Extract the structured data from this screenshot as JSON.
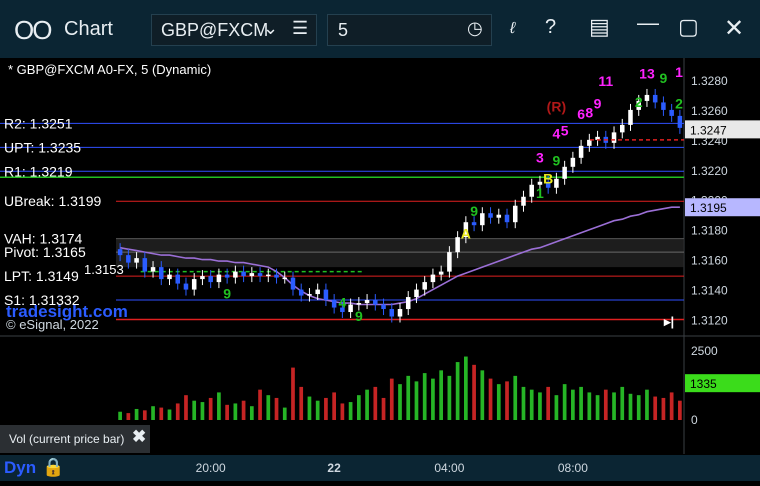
{
  "window": {
    "title": "Chart",
    "symbol": "GBP@FXCM",
    "interval": "5"
  },
  "chart_header": "* GBP@FXCM A0-FX, 5 (Dynamic)",
  "copyright": "© eSignal, 2022",
  "watermark": "tradesight.com",
  "study_label": "Vol (current price bar)",
  "bottom": {
    "label": "Dyn"
  },
  "colors": {
    "background": "#000000",
    "up_candle": "#ffffff",
    "down_candle": "#2b5cff",
    "ma_line": "#9b6fd6",
    "r2_line": "#3050ff",
    "r1_line": "#3050ff",
    "ubreak_line": "#e02020",
    "green_line": "#21c021",
    "vah_band": "#2a2a2a",
    "current_price": "#e8e8e8",
    "ma_price": "#b7b7ff",
    "vol_current": "#3bdc1b"
  },
  "chart_data": {
    "type": "candlestick",
    "ylim": [
      1.3113,
      1.3292
    ],
    "yticks": [
      "1.3280",
      "1.3260",
      "1.3240",
      "1.3220",
      "1.3200",
      "1.3180",
      "1.3160",
      "1.3140",
      "1.3120"
    ],
    "xticks": [
      {
        "i": 11,
        "label": "20:00"
      },
      {
        "i": 26,
        "label": "22"
      },
      {
        "i": 40,
        "label": "04:00"
      },
      {
        "i": 55,
        "label": "08:00"
      }
    ],
    "n_bars": 69,
    "current_price": "1.3247",
    "ma_price": "1.3195",
    "levels": [
      {
        "label": "R2: 1.3251",
        "value": 1.3251,
        "type": "r2"
      },
      {
        "label": "UPT: 1.3235",
        "value": 1.3235,
        "type": "r2"
      },
      {
        "label": "R1: 1.3219",
        "value": 1.3219,
        "type": "r1"
      },
      {
        "label": "UBreak: 1.3199",
        "value": 1.3199,
        "type": "ubreak"
      },
      {
        "label": "VAH: 1.3174",
        "value": 1.3174,
        "type": "vah"
      },
      {
        "label": "Pivot: 1.3165",
        "value": 1.3165,
        "type": "pivot"
      },
      {
        "label": "LPT: 1.3149",
        "value": 1.3149,
        "type": "ubreak"
      },
      {
        "label": "S1: 1.31332",
        "value": 1.3133,
        "type": "r1"
      }
    ],
    "hidden_level_label": "1.3153",
    "close": [
      1.3163,
      1.3158,
      1.3161,
      1.3152,
      1.3155,
      1.3147,
      1.315,
      1.3144,
      1.314,
      1.3147,
      1.3149,
      1.3145,
      1.315,
      1.3148,
      1.3152,
      1.3149,
      1.3151,
      1.3149,
      1.315,
      1.3148,
      1.3148,
      1.314,
      1.3136,
      1.3137,
      1.314,
      1.3133,
      1.3128,
      1.3125,
      1.313,
      1.3131,
      1.3133,
      1.313,
      1.3127,
      1.3122,
      1.3127,
      1.3135,
      1.314,
      1.3145,
      1.315,
      1.3152,
      1.3165,
      1.3175,
      1.3185,
      1.3183,
      1.3191,
      1.3188,
      1.319,
      1.3185,
      1.3196,
      1.3202,
      1.321,
      1.3212,
      1.3208,
      1.3214,
      1.3222,
      1.3228,
      1.3236,
      1.324,
      1.3242,
      1.3238,
      1.3245,
      1.325,
      1.326,
      1.3266,
      1.327,
      1.3265,
      1.326,
      1.3256,
      1.3248
    ],
    "ma": [
      1.3168,
      1.3167,
      1.3166,
      1.3165,
      1.3164,
      1.3163,
      1.3163,
      1.3162,
      1.3161,
      1.3161,
      1.316,
      1.316,
      1.3159,
      1.3159,
      1.3158,
      1.3158,
      1.3157,
      1.3156,
      1.3155,
      1.3152,
      1.3148,
      1.3143,
      1.3139,
      1.3136,
      1.3134,
      1.3133,
      1.3132,
      1.3131,
      1.3131,
      1.313,
      1.313,
      1.313,
      1.313,
      1.313,
      1.3131,
      1.3132,
      1.3134,
      1.3137,
      1.314,
      1.3143,
      1.3146,
      1.3149,
      1.3151,
      1.3153,
      1.3155,
      1.3157,
      1.3159,
      1.3161,
      1.3163,
      1.3165,
      1.3167,
      1.3168,
      1.317,
      1.3172,
      1.3174,
      1.3176,
      1.3178,
      1.318,
      1.3182,
      1.3184,
      1.3186,
      1.3187,
      1.3189,
      1.319,
      1.3192,
      1.3193,
      1.3194,
      1.3195,
      1.3195
    ],
    "volume": [
      300,
      250,
      400,
      350,
      500,
      450,
      380,
      600,
      900,
      700,
      650,
      800,
      1000,
      550,
      600,
      700,
      500,
      1100,
      900,
      800,
      450,
      1900,
      1200,
      850,
      700,
      800,
      1000,
      600,
      650,
      900,
      1100,
      1200,
      800,
      1500,
      1300,
      1600,
      1400,
      1700,
      1500,
      1800,
      1600,
      2100,
      2300,
      2000,
      1800,
      1500,
      1300,
      1400,
      1600,
      1200,
      1100,
      1000,
      1200,
      900,
      1300,
      1100,
      1200,
      1000,
      900,
      1100,
      1000,
      1200,
      950,
      900,
      1100,
      850,
      800,
      1000,
      700
    ],
    "vol_ylim": [
      0,
      2900
    ],
    "vol_ticks": [
      "2500",
      "0"
    ],
    "vol_current": "1335",
    "annotations": [
      {
        "text": "(R)",
        "i": 53,
        "v": 1.3259,
        "color": "#b01818"
      },
      {
        "text": "11",
        "i": 59,
        "v": 1.3276,
        "color": "#ff22ff"
      },
      {
        "text": "9",
        "i": 58,
        "v": 1.3261,
        "color": "#ff22ff"
      },
      {
        "text": "6",
        "i": 56,
        "v": 1.3254,
        "color": "#ff22ff"
      },
      {
        "text": "8",
        "i": 57,
        "v": 1.3255,
        "color": "#ff22ff"
      },
      {
        "text": "5",
        "i": 54,
        "v": 1.3243,
        "color": "#ff22ff"
      },
      {
        "text": "4",
        "i": 53,
        "v": 1.3241,
        "color": "#ff22ff"
      },
      {
        "text": "3",
        "i": 51,
        "v": 1.3225,
        "color": "#ff22ff"
      },
      {
        "text": "13",
        "i": 64,
        "v": 1.3281,
        "color": "#ff22ff"
      },
      {
        "text": "9",
        "i": 66,
        "v": 1.3278,
        "color": "#21c021"
      },
      {
        "text": "2",
        "i": 63,
        "v": 1.3262,
        "color": "#21c021"
      },
      {
        "text": "2",
        "i": 71,
        "v": 1.3261,
        "color": "#21c021"
      },
      {
        "text": "1",
        "i": 71,
        "v": 1.3282,
        "color": "#ff22ff"
      },
      {
        "text": "9",
        "i": 53,
        "v": 1.3223,
        "color": "#21c021"
      },
      {
        "text": "B",
        "i": 52,
        "v": 1.3211,
        "color": "#e8e820"
      },
      {
        "text": "1",
        "i": 51,
        "v": 1.3201,
        "color": "#21c021"
      },
      {
        "text": "9",
        "i": 43,
        "v": 1.3189,
        "color": "#21c021"
      },
      {
        "text": "A",
        "i": 42,
        "v": 1.3174,
        "color": "#e8e820"
      },
      {
        "text": "9",
        "i": 13,
        "v": 1.3134,
        "color": "#21c021"
      },
      {
        "text": "4",
        "i": 27,
        "v": 1.3128,
        "color": "#21c021"
      },
      {
        "text": "9",
        "i": 29,
        "v": 1.3119,
        "color": "#21c021"
      }
    ]
  }
}
